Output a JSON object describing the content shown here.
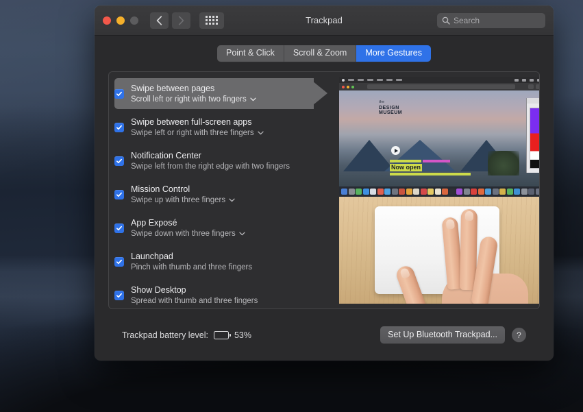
{
  "window": {
    "title": "Trackpad",
    "traffic_lights": [
      "close-red",
      "minimize-yellow",
      "zoom-disabled-gray"
    ],
    "nav_back_label": "Back",
    "nav_forward_label": "Forward",
    "show_all_label": "Show All",
    "search": {
      "placeholder": "Search",
      "value": "",
      "icon": "search-icon"
    }
  },
  "tabs": [
    {
      "label": "Point & Click",
      "active": false
    },
    {
      "label": "Scroll & Zoom",
      "active": false
    },
    {
      "label": "More Gestures",
      "active": true
    }
  ],
  "accent_color": "#2f72e8",
  "gestures": [
    {
      "title": "Swipe between pages",
      "subtitle": "Scroll left or right with two fingers",
      "checked": true,
      "has_chevron": true,
      "selected": true
    },
    {
      "title": "Swipe between full-screen apps",
      "subtitle": "Swipe left or right with three fingers",
      "checked": true,
      "has_chevron": true,
      "selected": false
    },
    {
      "title": "Notification Center",
      "subtitle": "Swipe left from the right edge with two fingers",
      "checked": true,
      "has_chevron": false,
      "selected": false
    },
    {
      "title": "Mission Control",
      "subtitle": "Swipe up with three fingers",
      "checked": true,
      "has_chevron": true,
      "selected": false
    },
    {
      "title": "App Exposé",
      "subtitle": "Swipe down with three fingers",
      "checked": true,
      "has_chevron": true,
      "selected": false
    },
    {
      "title": "Launchpad",
      "subtitle": "Pinch with thumb and three fingers",
      "checked": true,
      "has_chevron": false,
      "selected": false
    },
    {
      "title": "Show Desktop",
      "subtitle": "Spread with thumb and three fingers",
      "checked": true,
      "has_chevron": false,
      "selected": false
    }
  ],
  "preview": {
    "screen_demo_alt": "Safari window showing the Design Museum website",
    "site_logo_line1": "the",
    "site_logo_line2": "DESIGN",
    "site_logo_line3": "MUSEUM",
    "site_caption": "Now open",
    "hand_demo_alt": "Hand swiping with two fingers on a Magic Trackpad"
  },
  "footer": {
    "battery_label": "Trackpad battery level:",
    "battery_percent": "53%",
    "battery_fill_ratio": 0.53,
    "setup_button": "Set Up Bluetooth Trackpad...",
    "help_button": "?"
  }
}
